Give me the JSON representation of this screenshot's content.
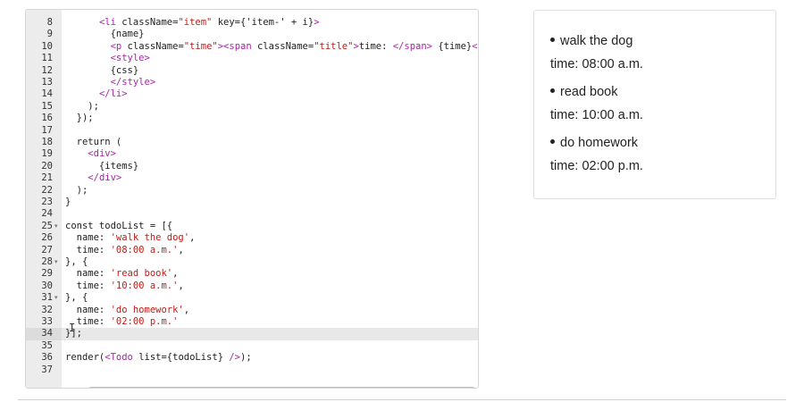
{
  "editor": {
    "lines": [
      {
        "num": "8",
        "fold": "",
        "segs": [
          [
            "      ",
            "t-plain"
          ],
          [
            "<li",
            "t-tag"
          ],
          [
            " className=",
            "t-attr"
          ],
          [
            "\"item\"",
            "t-str"
          ],
          [
            " key=",
            "t-attr"
          ],
          [
            "{'item-' + i}",
            "t-plain"
          ],
          [
            ">",
            "t-tag"
          ]
        ]
      },
      {
        "num": "9",
        "fold": "",
        "segs": [
          [
            "        {name}",
            "t-plain"
          ]
        ]
      },
      {
        "num": "10",
        "fold": "",
        "segs": [
          [
            "        ",
            "t-plain"
          ],
          [
            "<p",
            "t-tag"
          ],
          [
            " className=",
            "t-attr"
          ],
          [
            "\"time\"",
            "t-str"
          ],
          [
            ">",
            "t-tag"
          ],
          [
            "<span",
            "t-tag"
          ],
          [
            " className=",
            "t-attr"
          ],
          [
            "\"title\"",
            "t-str"
          ],
          [
            ">",
            "t-tag"
          ],
          [
            "time: ",
            "t-plain"
          ],
          [
            "</span>",
            "t-tag"
          ],
          [
            " {time}",
            "t-plain"
          ],
          [
            "</",
            "t-tag"
          ]
        ]
      },
      {
        "num": "11",
        "fold": "",
        "segs": [
          [
            "        ",
            "t-plain"
          ],
          [
            "<style>",
            "t-tag"
          ]
        ]
      },
      {
        "num": "12",
        "fold": "",
        "segs": [
          [
            "        {css}",
            "t-plain"
          ]
        ]
      },
      {
        "num": "13",
        "fold": "",
        "segs": [
          [
            "        ",
            "t-plain"
          ],
          [
            "</style>",
            "t-tag"
          ]
        ]
      },
      {
        "num": "14",
        "fold": "",
        "segs": [
          [
            "      ",
            "t-plain"
          ],
          [
            "</li>",
            "t-tag"
          ]
        ]
      },
      {
        "num": "15",
        "fold": "",
        "segs": [
          [
            "    );",
            "t-plain"
          ]
        ]
      },
      {
        "num": "16",
        "fold": "",
        "segs": [
          [
            "  });",
            "t-plain"
          ]
        ]
      },
      {
        "num": "17",
        "fold": "",
        "segs": [
          [
            "",
            "t-plain"
          ]
        ]
      },
      {
        "num": "18",
        "fold": "",
        "segs": [
          [
            "  return (",
            "t-kw"
          ]
        ]
      },
      {
        "num": "19",
        "fold": "",
        "segs": [
          [
            "    ",
            "t-plain"
          ],
          [
            "<div>",
            "t-tag"
          ]
        ]
      },
      {
        "num": "20",
        "fold": "",
        "segs": [
          [
            "      {items}",
            "t-plain"
          ]
        ]
      },
      {
        "num": "21",
        "fold": "",
        "segs": [
          [
            "    ",
            "t-plain"
          ],
          [
            "</div>",
            "t-tag"
          ]
        ]
      },
      {
        "num": "22",
        "fold": "",
        "segs": [
          [
            "  );",
            "t-plain"
          ]
        ]
      },
      {
        "num": "23",
        "fold": "",
        "segs": [
          [
            "}",
            "t-plain"
          ]
        ]
      },
      {
        "num": "24",
        "fold": "",
        "segs": [
          [
            "",
            "t-plain"
          ]
        ]
      },
      {
        "num": "25",
        "fold": "▾",
        "segs": [
          [
            "const todoList = [{",
            "t-plain"
          ]
        ]
      },
      {
        "num": "26",
        "fold": "",
        "segs": [
          [
            "  name: ",
            "t-plain"
          ],
          [
            "'walk the dog'",
            "t-str"
          ],
          [
            ",",
            "t-plain"
          ]
        ]
      },
      {
        "num": "27",
        "fold": "",
        "segs": [
          [
            "  time: ",
            "t-plain"
          ],
          [
            "'08:00 a.m.'",
            "t-str"
          ],
          [
            ",",
            "t-plain"
          ]
        ]
      },
      {
        "num": "28",
        "fold": "▾",
        "segs": [
          [
            "}, {",
            "t-plain"
          ]
        ]
      },
      {
        "num": "29",
        "fold": "",
        "segs": [
          [
            "  name: ",
            "t-plain"
          ],
          [
            "'read book'",
            "t-str"
          ],
          [
            ",",
            "t-plain"
          ]
        ]
      },
      {
        "num": "30",
        "fold": "",
        "segs": [
          [
            "  time: ",
            "t-plain"
          ],
          [
            "'10:00 a.m.'",
            "t-str"
          ],
          [
            ",",
            "t-plain"
          ]
        ]
      },
      {
        "num": "31",
        "fold": "▾",
        "segs": [
          [
            "}, {",
            "t-plain"
          ]
        ]
      },
      {
        "num": "32",
        "fold": "",
        "segs": [
          [
            "  name: ",
            "t-plain"
          ],
          [
            "'do homework'",
            "t-str"
          ],
          [
            ",",
            "t-plain"
          ]
        ]
      },
      {
        "num": "33",
        "fold": "",
        "segs": [
          [
            "  time: ",
            "t-plain"
          ],
          [
            "'02:00 p.m.'",
            "t-str"
          ]
        ]
      },
      {
        "num": "34",
        "fold": "",
        "active": true,
        "segs": [
          [
            "}];",
            "t-plain"
          ]
        ]
      },
      {
        "num": "35",
        "fold": "",
        "segs": [
          [
            "",
            "t-plain"
          ]
        ]
      },
      {
        "num": "36",
        "fold": "",
        "segs": [
          [
            "render(",
            "t-plain"
          ],
          [
            "<Todo",
            "t-tag"
          ],
          [
            " list={todoList} ",
            "t-plain"
          ],
          [
            "/>",
            "t-tag"
          ],
          [
            ");",
            "t-plain"
          ]
        ]
      },
      {
        "num": "37",
        "fold": "",
        "segs": [
          [
            "",
            "t-plain"
          ]
        ]
      }
    ]
  },
  "preview": {
    "items": [
      {
        "name": "walk the dog",
        "time": "time: 08:00 a.m."
      },
      {
        "name": "read book",
        "time": "time: 10:00 a.m."
      },
      {
        "name": "do homework",
        "time": "time: 02:00 p.m."
      }
    ]
  }
}
